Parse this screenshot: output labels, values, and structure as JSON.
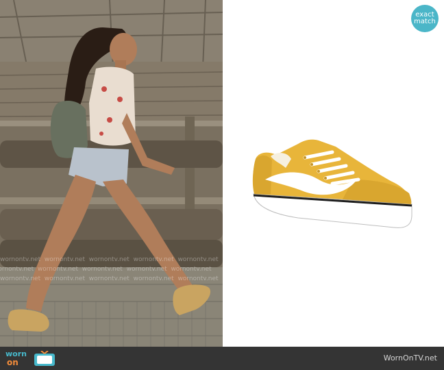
{
  "badge": {
    "line1": "exact",
    "line2": "match"
  },
  "footer": {
    "logo_worn": "worn",
    "logo_on": "on",
    "logo_tv": "tv",
    "site": "WornOnTV.net"
  },
  "scene": {
    "watermark_text": "wornontv.net"
  },
  "product": {
    "icon": "sneaker-image"
  },
  "colors": {
    "badge": "#4bb6c8",
    "footer_bg": "#343434",
    "shoe_yellow": "#e8b53a",
    "logo_teal": "#47b9cc",
    "logo_orange": "#f28c3b"
  }
}
